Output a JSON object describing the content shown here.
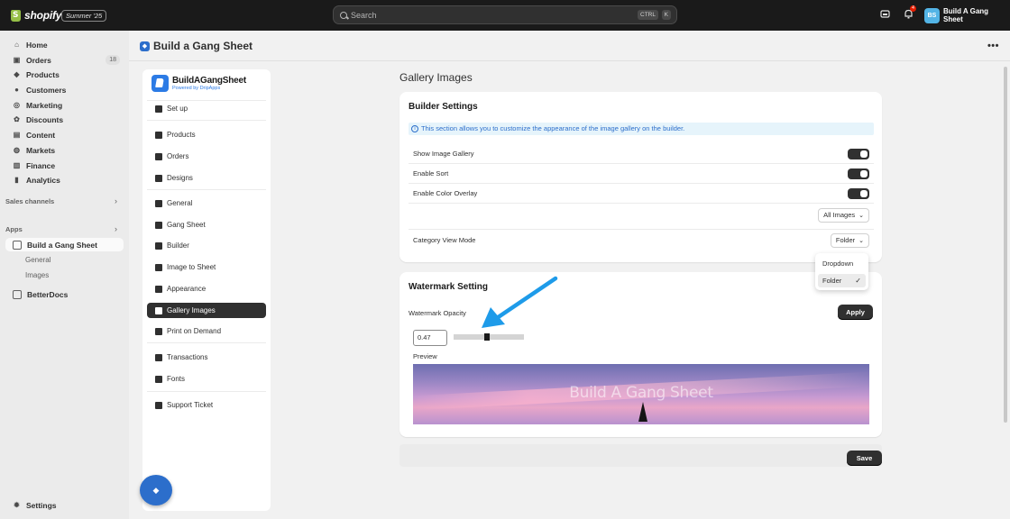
{
  "topbar": {
    "logo_text": "shopify",
    "badge": "Summer '25",
    "search_placeholder": "Search",
    "kbd_ctrl": "CTRL",
    "kbd_k": "K",
    "notification_count": "4",
    "store_initials": "BS",
    "store_name": "Build A Gang Sheet"
  },
  "sidebar": {
    "items": [
      {
        "label": "Home",
        "icon": "home-icon"
      },
      {
        "label": "Orders",
        "icon": "orders-icon",
        "count": "18"
      },
      {
        "label": "Products",
        "icon": "tag-icon"
      },
      {
        "label": "Customers",
        "icon": "person-icon"
      },
      {
        "label": "Marketing",
        "icon": "target-icon"
      },
      {
        "label": "Discounts",
        "icon": "discount-icon"
      },
      {
        "label": "Content",
        "icon": "content-icon"
      },
      {
        "label": "Markets",
        "icon": "globe-icon"
      },
      {
        "label": "Finance",
        "icon": "bank-icon"
      },
      {
        "label": "Analytics",
        "icon": "chart-icon"
      }
    ],
    "sales_channels_label": "Sales channels",
    "apps_label": "Apps",
    "app_active": "Build a Gang Sheet",
    "app_subitems": [
      "General",
      "Images"
    ],
    "app_other": "BetterDocs",
    "settings_label": "Settings"
  },
  "page": {
    "title": "Build a Gang Sheet"
  },
  "app_nav": {
    "brand_name": "BuildAGangSheet",
    "brand_sub": "Powered by DripApps",
    "items": [
      "Set up",
      "Products",
      "Orders",
      "Designs",
      "General",
      "Gang Sheet",
      "Builder",
      "Image to Sheet",
      "Appearance",
      "Gallery Images",
      "Print on Demand",
      "Transactions",
      "Fonts",
      "Support Ticket"
    ],
    "active": "Gallery Images"
  },
  "content": {
    "title": "Gallery Images",
    "builder_settings": {
      "title": "Builder Settings",
      "info": "This section allows you to customize the appearance of the image gallery on the builder.",
      "show_gallery": "Show Image Gallery",
      "enable_sort": "Enable Sort",
      "enable_color_overlay": "Enable Color Overlay",
      "all_images_select": "All Images",
      "category_view_mode_label": "Category View Mode",
      "category_view_mode_value": "Folder",
      "dropdown_options": [
        "Dropdown",
        "Folder"
      ],
      "toggles": {
        "show_gallery": true,
        "enable_sort": true,
        "enable_color_overlay": true
      }
    },
    "watermark": {
      "title": "Watermark Setting",
      "opacity_label": "Watermark Opacity",
      "apply_label": "Apply",
      "opacity_value": "0.47",
      "slider_fraction": 0.47,
      "preview_label": "Preview",
      "preview_text": "Build A Gang Sheet"
    },
    "save_label": "Save"
  },
  "colors": {
    "topbar": "#1a1a1a",
    "accent_blue": "#2c6ecb",
    "arrow": "#1e9be9",
    "dark_button": "#303030"
  }
}
